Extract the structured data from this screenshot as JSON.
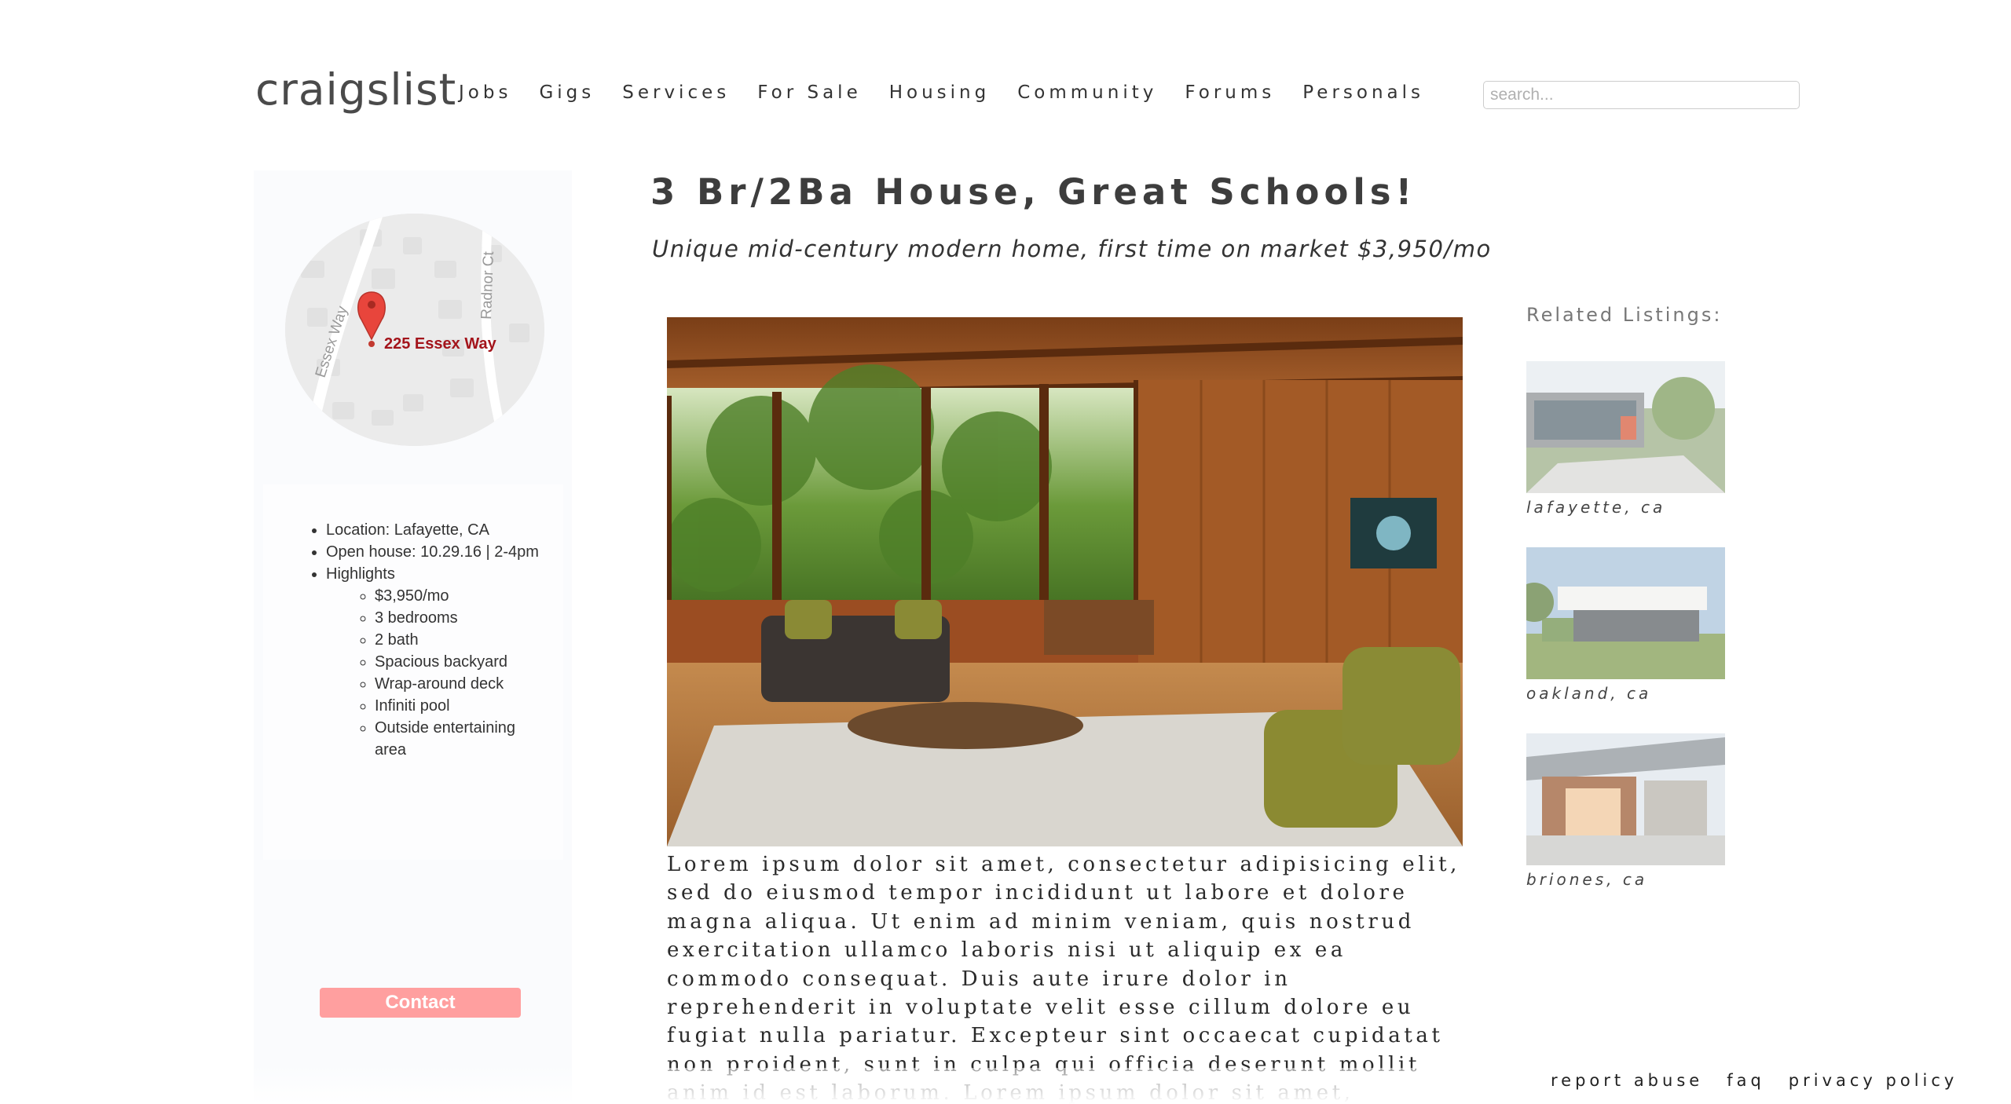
{
  "header": {
    "logo": "craigslist",
    "nav": [
      "Jobs",
      "Gigs",
      "Services",
      "For Sale",
      "Housing",
      "Community",
      "Forums",
      "Personals"
    ],
    "search_placeholder": "search..."
  },
  "sidebar": {
    "map": {
      "address": "225 Essex Way",
      "street_labels": [
        "Essex Way",
        "Radnor Ct"
      ],
      "icon": "map-pin-icon",
      "pin_color": "#e8453c"
    },
    "details": {
      "location": "Location: Lafayette, CA",
      "open_house": "Open house: 10.29.16 | 2-4pm",
      "highlights_label": "Highlights",
      "highlights": [
        "$3,950/mo",
        "3 bedrooms",
        "2 bath",
        "Spacious backyard",
        "Wrap-around deck",
        "Infiniti pool",
        "Outside entertaining area"
      ]
    },
    "contact_label": "Contact",
    "contact_color": "#ff9f9f"
  },
  "listing": {
    "title": "3 Br/2Ba House, Great Schools!",
    "subtitle": "Unique mid-century modern home, first time on market $3,950/mo",
    "body": "Lorem ipsum dolor sit amet, consectetur adipisicing elit, sed do eiusmod tempor incididunt ut labore et dolore magna aliqua. Ut enim ad minim veniam, quis nostrud exercitation ullamco laboris nisi ut aliquip ex ea commodo consequat. Duis aute irure dolor in reprehenderit in voluptate velit esse cillum dolore eu fugiat nulla pariatur. Excepteur sint occaecat cupidatat non proident, sunt in culpa qui officia deserunt mollit anim id est laborum. Lorem ipsum dolor sit amet, consectetur adipisicing elit, sed do eiusmod tempor"
  },
  "related": {
    "heading": "Related Listings:",
    "items": [
      {
        "caption": "lafayette, ca"
      },
      {
        "caption": "oakland, ca"
      },
      {
        "caption": "briones, ca"
      }
    ]
  },
  "footer": {
    "links": [
      "report abuse",
      "faq",
      "privacy policy"
    ]
  }
}
